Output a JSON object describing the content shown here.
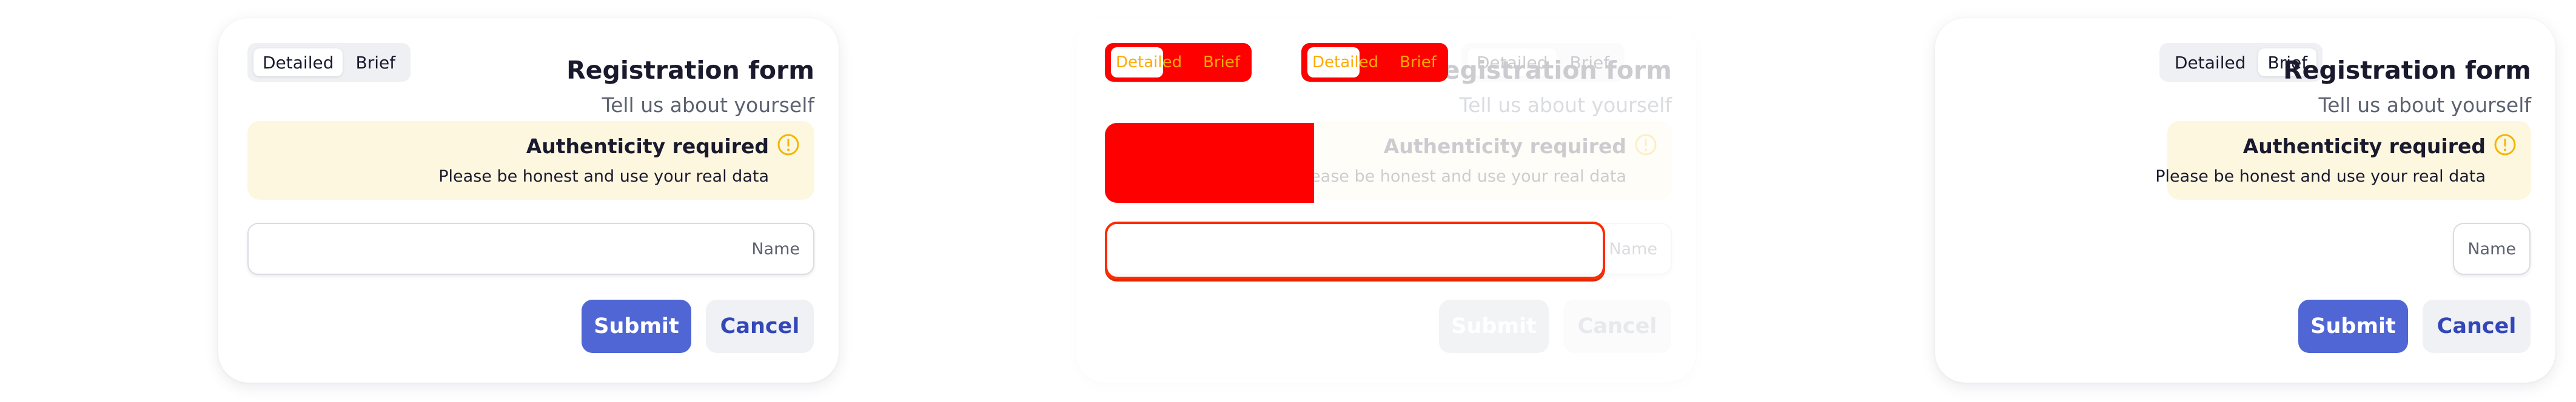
{
  "form": {
    "segment_options": [
      "Detailed",
      "Brief"
    ],
    "title": "Registration form",
    "subtitle": "Tell us about yourself",
    "alert": {
      "title": "Authenticity required",
      "message": "Please be honest and use your real data",
      "icon": "warning-circle-icon"
    },
    "name_placeholder": "Name",
    "submit_label": "Submit",
    "cancel_label": "Cancel"
  },
  "colors": {
    "primary": "#4f66d4",
    "alert_bg": "#fef7e0",
    "alert_icon": "#f2b600",
    "debug_highlight": "#ff0000",
    "debug_text": "#ffaa00"
  }
}
